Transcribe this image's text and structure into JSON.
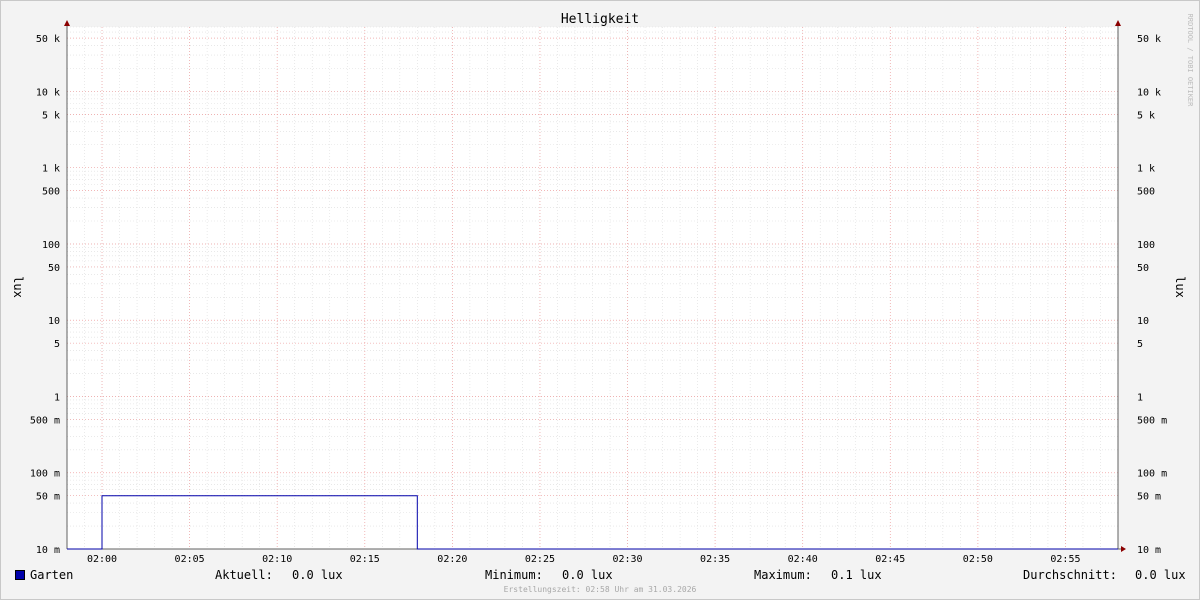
{
  "chart_data": {
    "type": "line",
    "title": "Helligkeit",
    "ylabel": "lux",
    "ylabel_right": "lux",
    "y_scale": "log",
    "ylim": [
      0.01,
      70000
    ],
    "x_tick_labels": [
      "02:00",
      "02:05",
      "02:10",
      "02:15",
      "02:20",
      "02:25",
      "02:30",
      "02:35",
      "02:40",
      "02:45",
      "02:50",
      "02:55"
    ],
    "x_range": [
      "01:58",
      "02:58"
    ],
    "y_ticks": [
      {
        "value": 50000,
        "label": "50 k"
      },
      {
        "value": 10000,
        "label": "10 k"
      },
      {
        "value": 5000,
        "label": "5 k"
      },
      {
        "value": 1000,
        "label": "1 k"
      },
      {
        "value": 500,
        "label": "500"
      },
      {
        "value": 100,
        "label": "100"
      },
      {
        "value": 50,
        "label": "50"
      },
      {
        "value": 10,
        "label": "10"
      },
      {
        "value": 5,
        "label": "5"
      },
      {
        "value": 1,
        "label": "1"
      },
      {
        "value": 0.5,
        "label": "500 m"
      },
      {
        "value": 0.1,
        "label": "100 m"
      },
      {
        "value": 0.05,
        "label": "50 m"
      },
      {
        "value": 0.01,
        "label": "10 m"
      }
    ],
    "series": [
      {
        "name": "Garten",
        "color": "#0000aa",
        "points": [
          {
            "x": "01:58",
            "y": 0
          },
          {
            "x": "02:00",
            "y": 0
          },
          {
            "x": "02:00",
            "y": 0.05
          },
          {
            "x": "02:18",
            "y": 0.05
          },
          {
            "x": "02:18",
            "y": 0
          },
          {
            "x": "02:58",
            "y": 0
          }
        ]
      }
    ],
    "grid": true,
    "watermark": "RRDTOOL / TOBI OETIKER"
  },
  "legend": {
    "series_name": "Garten",
    "aktuell_label": "Aktuell:",
    "aktuell_value": "0.0 lux",
    "minimum_label": "Minimum:",
    "minimum_value": "0.0 lux",
    "maximum_label": "Maximum:",
    "maximum_value": "0.1 lux",
    "durchschnitt_label": "Durchschnitt:",
    "durchschnitt_value": "0.0 lux"
  },
  "footer": "Erstellungszeit: 02:58 Uhr am 31.03.2026"
}
